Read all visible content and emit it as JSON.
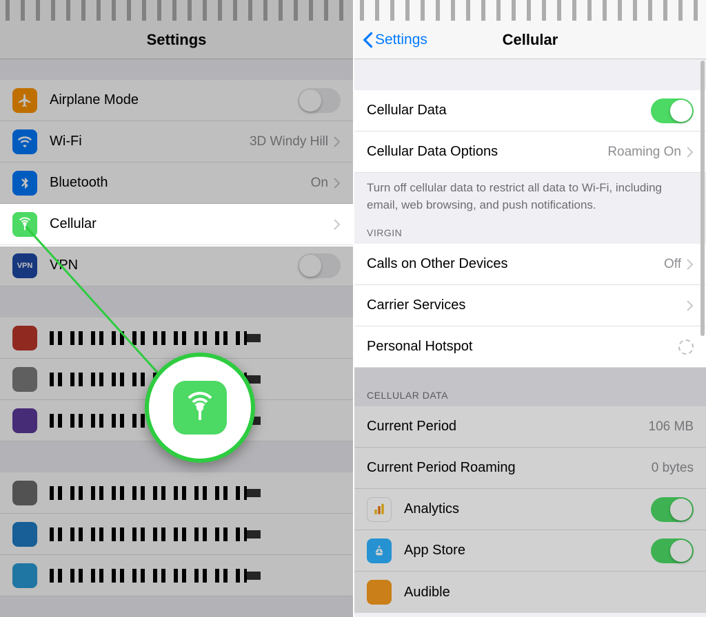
{
  "left": {
    "title": "Settings",
    "rows": {
      "airplane": "Airplane Mode",
      "wifi": "Wi-Fi",
      "wifi_val": "3D Windy Hill",
      "bt": "Bluetooth",
      "bt_val": "On",
      "cellular": "Cellular",
      "vpn": "VPN"
    }
  },
  "right": {
    "back": "Settings",
    "title": "Cellular",
    "cellular_data": "Cellular Data",
    "options": "Cellular Data Options",
    "options_val": "Roaming On",
    "footer": "Turn off cellular data to restrict all data to Wi-Fi, including email, web browsing, and push notifications.",
    "carrier_header": "VIRGIN",
    "calls_other": "Calls on Other Devices",
    "calls_other_val": "Off",
    "carrier_services": "Carrier Services",
    "hotspot": "Personal Hotspot",
    "usage_header": "CELLULAR DATA",
    "current_period": "Current Period",
    "current_period_val": "106 MB",
    "current_roaming": "Current Period Roaming",
    "current_roaming_val": "0 bytes",
    "analytics": "Analytics",
    "appstore": "App Store",
    "audible": "Audible"
  }
}
